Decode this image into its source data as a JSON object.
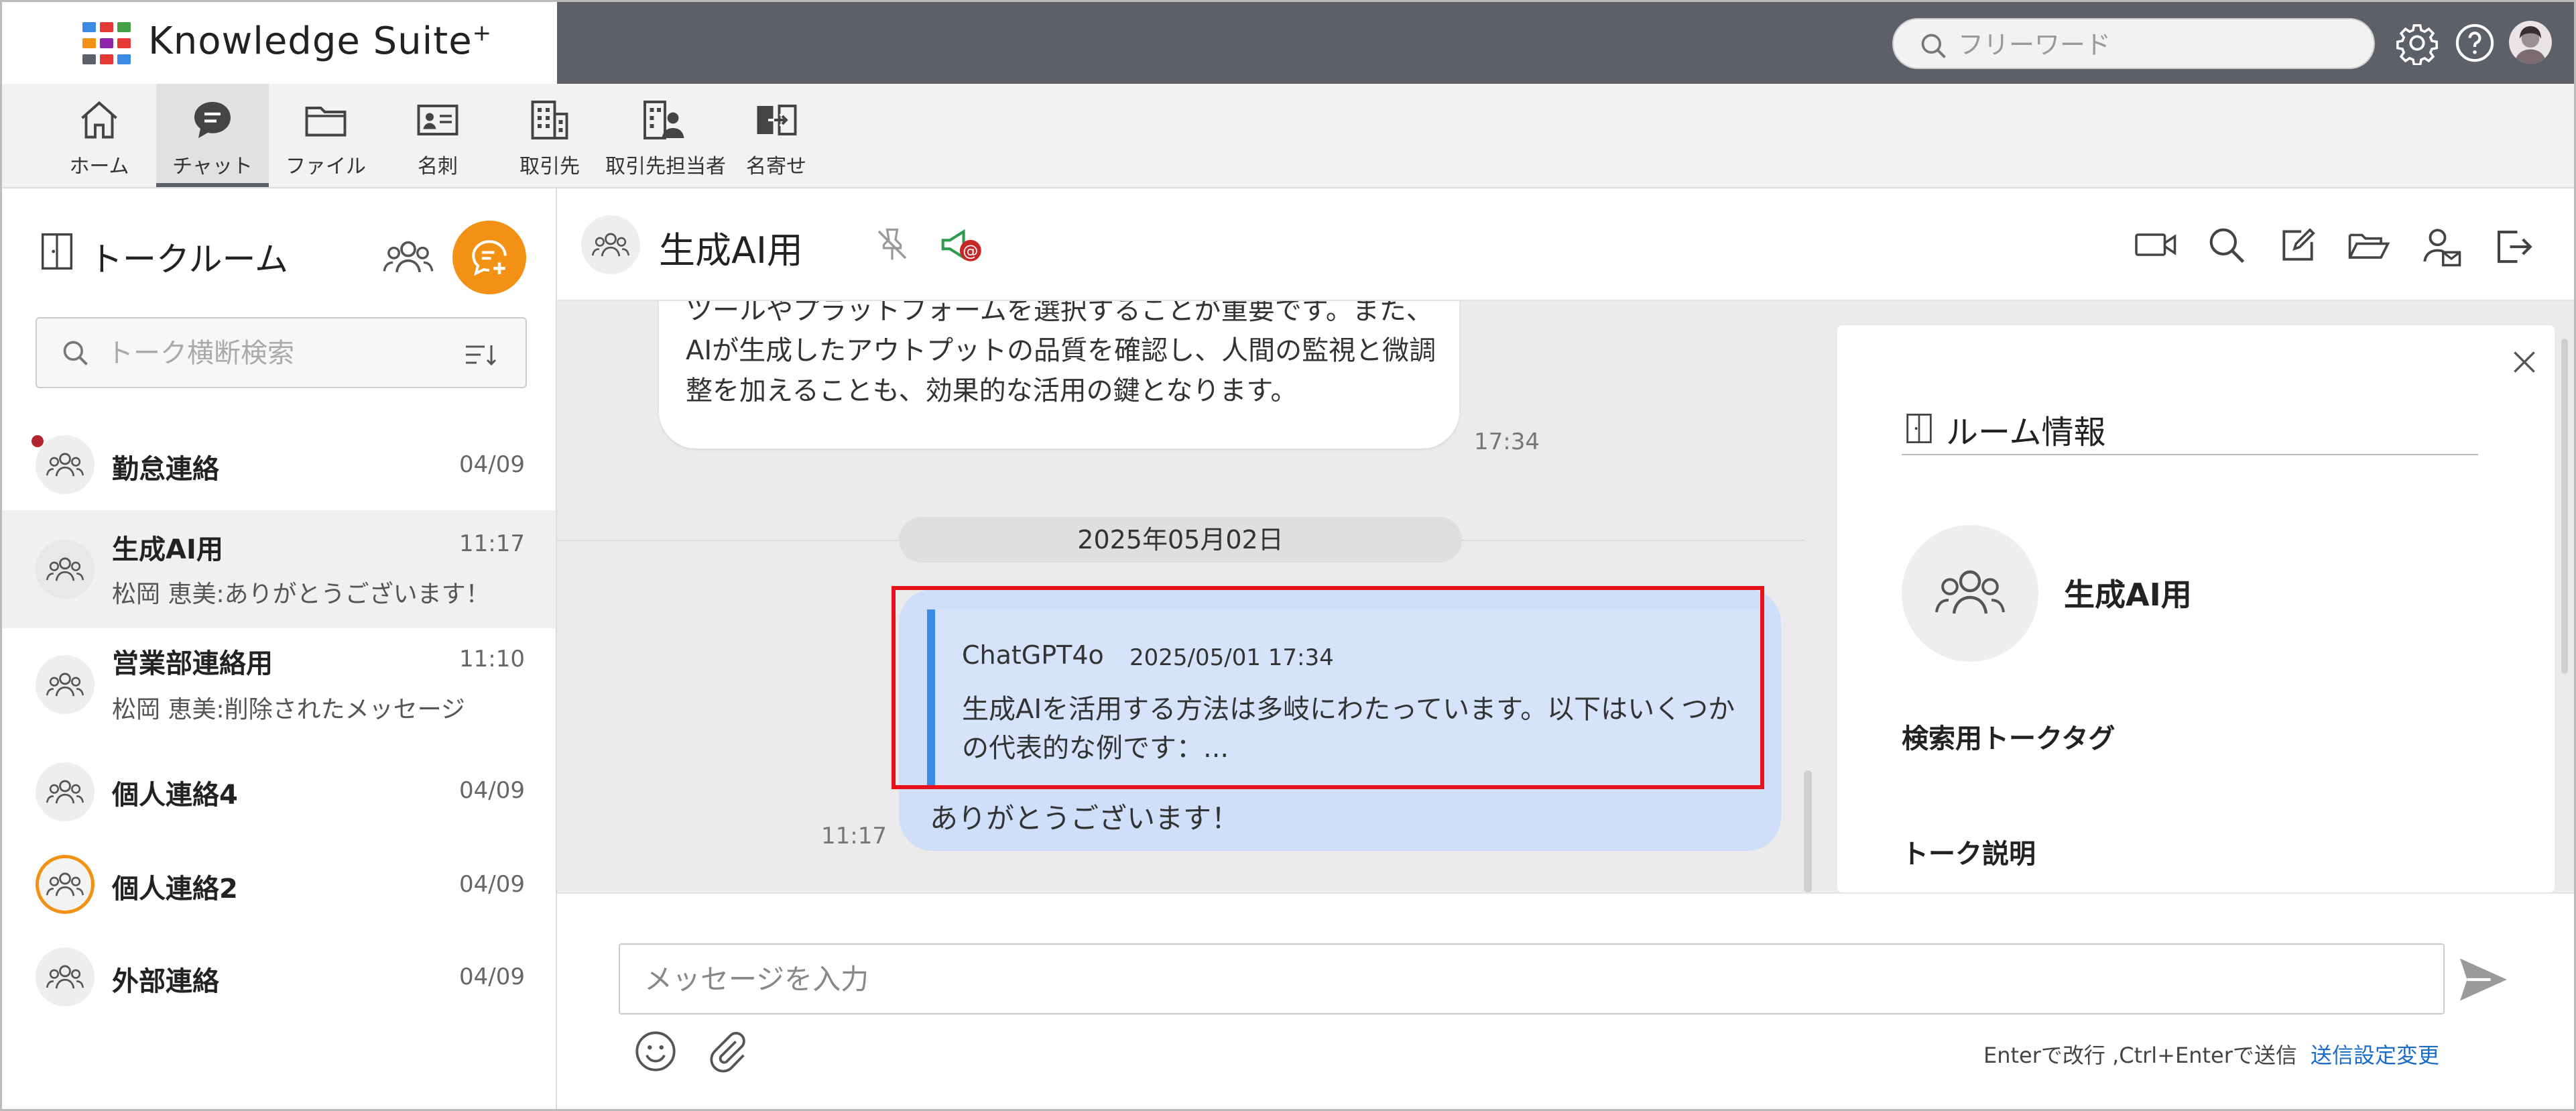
{
  "app": {
    "name": "Knowledge Suite",
    "name_sup": "+"
  },
  "search": {
    "placeholder": "フリーワード"
  },
  "header_icons": [
    "gear-icon",
    "help-icon",
    "user-avatar"
  ],
  "toolbar": {
    "items": [
      {
        "label": "ホーム",
        "icon": "home-icon"
      },
      {
        "label": "チャット",
        "icon": "chat-icon",
        "active": true
      },
      {
        "label": "ファイル",
        "icon": "folder-icon"
      },
      {
        "label": "名刺",
        "icon": "business-card-icon"
      },
      {
        "label": "取引先",
        "icon": "building-icon"
      },
      {
        "label": "取引先担当者",
        "icon": "contact-person-icon"
      },
      {
        "label": "名寄せ",
        "icon": "merge-icon"
      }
    ]
  },
  "talk_panel": {
    "title": "トークルーム",
    "search_placeholder": "トーク横断検索",
    "rooms": [
      {
        "name": "勤怠連絡",
        "time": "04/09",
        "last": "",
        "unread": true
      },
      {
        "name": "生成AI用",
        "time": "11:17",
        "last": "松岡 恵美:ありがとうございます！",
        "selected": true
      },
      {
        "name": "営業部連絡用",
        "time": "11:10",
        "last": "松岡 恵美:削除されたメッセージ"
      },
      {
        "name": "個人連絡4",
        "time": "04/09",
        "last": ""
      },
      {
        "name": "個人連絡2",
        "time": "04/09",
        "last": "",
        "highlight": true
      },
      {
        "name": "外部連絡",
        "time": "04/09",
        "last": ""
      }
    ]
  },
  "chat": {
    "room_title": "生成AI用",
    "prev_message": {
      "text": "ツールやプラットフォームを選択することが重要です。また、AIが生成したアウトプットの品質を確認し、人間の監視と微調整を加えることも、効果的な活用の鍵となります。",
      "time": "17:34"
    },
    "date_separator": "2025年05月02日",
    "my_message": {
      "quote_author": "ChatGPT4o",
      "quote_date": "2025/05/01 17:34",
      "quote_text": "生成AIを活用する方法は多岐にわたっています。以下はいくつかの代表的な例です：...",
      "text": "ありがとうございます！",
      "time": "11:17"
    }
  },
  "room_info": {
    "title": "ルーム情報",
    "room_name": "生成AI用",
    "tag_label": "検索用トークタグ",
    "desc_label": "トーク説明"
  },
  "composer": {
    "placeholder": "メッセージを入力",
    "hint": "Enterで改行 ,Ctrl+Enterで送信",
    "settings_link": "送信設定変更"
  },
  "colors": {
    "accent": "#f39114",
    "header": "#5d5f69",
    "my_bubble": "#cfdffa",
    "quote_bar": "#3b8ae3",
    "highlight_box": "#e8121c",
    "link": "#1a6cc8"
  }
}
